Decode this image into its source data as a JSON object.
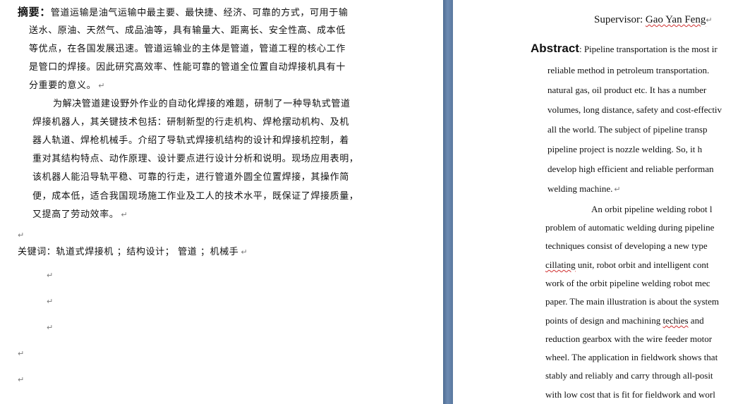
{
  "left": {
    "abstract_label": "摘要：",
    "para1_lines": [
      "管道运输是油气运输中最主要、最快捷、经济、可靠的方式，可用于输",
      "送水、原油、天然气、成品油等，具有输量大、距离长、安全性高、成本低",
      "等优点，在各国发展迅速。管道运输业的主体是管道，管道工程的核心工作",
      "是管口的焊接。因此研究高效率、性能可靠的管道全位置自动焊接机具有十",
      "分重要的意义。"
    ],
    "para2_lines": [
      "为解决管道建设野外作业的自动化焊接的难题，研制了一种导轨式管道",
      "焊接机器人，其关键技术包括：研制新型的行走机构、焊枪摆动机构、及机",
      "器人轨道、焊枪机械手。介绍了导轨式焊接机结构的设计和焊接机控制，着",
      "重对其结构特点、动作原理、设计要点进行设计分析和说明。现场应用表明，",
      "该机器人能沿导轨平稳、可靠的行走，进行管道外圆全位置焊接，其操作简",
      "便，成本低，适合我国现场施工作业及工人的技术水平，既保证了焊接质量，",
      "又提高了劳动效率。"
    ],
    "keywords_line": "关键词：轨道式焊接机  ；结构设计；  管道  ；机械手",
    "return_mark": "↵"
  },
  "right": {
    "supervisor_prefix": "Supervisor: ",
    "supervisor_name": "Gao Yan Feng",
    "abstract_label": "Abstract",
    "abstract_first": ": Pipeline transportation is the most ir",
    "para1_lines": [
      "reliable method in petroleum transportation.",
      "natural gas, oil product etc. It has a number",
      "volumes, long distance, safety and cost-effectiv",
      "all the world. The subject of pipeline transp",
      "pipeline project is nozzle welding. So, it h",
      "develop high efficient and reliable performan",
      "welding machine."
    ],
    "para2_lines": [
      "An orbit pipeline welding robot l",
      "problem of automatic welding during pipeline",
      "techniques consist of developing a new type",
      "cillating unit, robot orbit and intelligent cont",
      "work of the orbit pipeline welding robot mec",
      "paper. The main illustration is about the system",
      "points of design and machining techies and",
      "reduction gearbox with the wire feeder motor",
      "wheel. The application in fieldwork shows that",
      "stably and reliably and carry through all-posit",
      "with low cost that is fit for fieldwork and worl"
    ]
  }
}
